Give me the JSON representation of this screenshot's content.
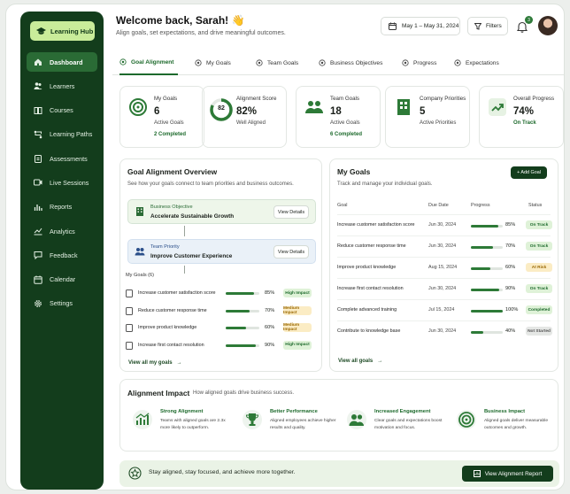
{
  "brand": {
    "name": "Learning Hub"
  },
  "nav": [
    {
      "label": "Dashboard",
      "icon": "home-icon",
      "active": true
    },
    {
      "label": "Learners",
      "icon": "users-icon"
    },
    {
      "label": "Courses",
      "icon": "book-icon"
    },
    {
      "label": "Learning Paths",
      "icon": "path-icon"
    },
    {
      "label": "Assessments",
      "icon": "clipboard-icon"
    },
    {
      "label": "Live Sessions",
      "icon": "video-icon"
    },
    {
      "label": "Reports",
      "icon": "bar-chart-icon"
    },
    {
      "label": "Analytics",
      "icon": "line-chart-icon"
    },
    {
      "label": "Feedback",
      "icon": "chat-icon"
    },
    {
      "label": "Calendar",
      "icon": "calendar-icon"
    },
    {
      "label": "Settings",
      "icon": "gear-icon"
    }
  ],
  "header": {
    "title": "Welcome back, Sarah! 👋",
    "subtitle": "Align goals, set expectations, and drive meaningful outcomes.",
    "date_range": "May 1 – May 31, 2024",
    "filters": "Filters",
    "notifications": "3"
  },
  "tabs": [
    "Goal Alignment",
    "My Goals",
    "Team Goals",
    "Business Objectives",
    "Progress",
    "Expectations"
  ],
  "kpis": [
    {
      "label": "My Goals",
      "value": "6",
      "sub": "Active Goals",
      "extra": "2 Completed"
    },
    {
      "label": "Alignment Score",
      "value": "82%",
      "sub": "Well Aligned",
      "ring": "82",
      "ring_fraction": 0.82
    },
    {
      "label": "Team Goals",
      "value": "18",
      "sub": "Active Goals",
      "extra": "6 Completed"
    },
    {
      "label": "Company Priorities",
      "value": "5",
      "sub": "Active Priorities"
    },
    {
      "label": "Overall Progress",
      "value": "74%",
      "sub": "On Track"
    }
  ],
  "overview": {
    "title": "Goal Alignment Overview",
    "subtitle": "See how your goals connect to team priorities and business outcomes.",
    "objective": {
      "type": "Business Objective",
      "name": "Accelerate Sustainable Growth",
      "action": "View Details"
    },
    "priority": {
      "type": "Team Priority",
      "name": "Improve Customer Experience",
      "action": "View Details"
    },
    "my_goals_label": "My Goals (6)",
    "goals": [
      {
        "name": "Increase customer satisfaction score",
        "pct": "85%",
        "progress": 0.85,
        "impact": "High Impact",
        "tone": "green"
      },
      {
        "name": "Reduce customer response time",
        "pct": "70%",
        "progress": 0.7,
        "impact": "Medium Impact",
        "tone": "amber"
      },
      {
        "name": "Improve product knowledge",
        "pct": "60%",
        "progress": 0.6,
        "impact": "Medium Impact",
        "tone": "amber"
      },
      {
        "name": "Increase first contact resolution",
        "pct": "90%",
        "progress": 0.9,
        "impact": "High Impact",
        "tone": "green"
      }
    ],
    "view_all": "View all my goals"
  },
  "my_goals": {
    "title": "My Goals",
    "subtitle": "Track and manage your individual goals.",
    "add": "+ Add Goal",
    "columns": [
      "Goal",
      "Due Date",
      "Progress",
      "Status"
    ],
    "rows": [
      {
        "goal": "Increase customer satisfaction score",
        "due": "Jun 30, 2024",
        "pct": "85%",
        "progress": 0.85,
        "status": "On Track",
        "tone": "green"
      },
      {
        "goal": "Reduce customer response time",
        "due": "Jun 30, 2024",
        "pct": "70%",
        "progress": 0.7,
        "status": "On Track",
        "tone": "green"
      },
      {
        "goal": "Improve product knowledge",
        "due": "Aug 15, 2024",
        "pct": "60%",
        "progress": 0.6,
        "status": "At Risk",
        "tone": "amber"
      },
      {
        "goal": "Increase first contact resolution",
        "due": "Jun 30, 2024",
        "pct": "90%",
        "progress": 0.9,
        "status": "On Track",
        "tone": "green"
      },
      {
        "goal": "Complete advanced training",
        "due": "Jul 15, 2024",
        "pct": "100%",
        "progress": 1.0,
        "status": "Completed",
        "tone": "green"
      },
      {
        "goal": "Contribute to knowledge base",
        "due": "Jun 30, 2024",
        "pct": "40%",
        "progress": 0.4,
        "status": "Not Started",
        "tone": "grey"
      }
    ],
    "view_all": "View all goals"
  },
  "impact": {
    "title": "Alignment Impact",
    "subtitle": "How aligned goals drive business success.",
    "items": [
      {
        "title": "Strong Alignment",
        "desc": "Teams with aligned goals are 2.3x more likely to outperform.",
        "icon": "growth-chart-icon"
      },
      {
        "title": "Better Performance",
        "desc": "Aligned employees achieve higher results and quality.",
        "icon": "trophy-icon"
      },
      {
        "title": "Increased Engagement",
        "desc": "Clear goals and expectations boost motivation and focus.",
        "icon": "team-icon"
      },
      {
        "title": "Business Impact",
        "desc": "Aligned goals deliver measurable outcomes and growth.",
        "icon": "target-icon"
      }
    ]
  },
  "footer": {
    "text": "Stay aligned, stay focused, and achieve more together.",
    "button": "View Alignment Report"
  },
  "colors": {
    "primary": "#133d1c",
    "accent": "#2d7a37",
    "mint": "#c9ec9a"
  }
}
